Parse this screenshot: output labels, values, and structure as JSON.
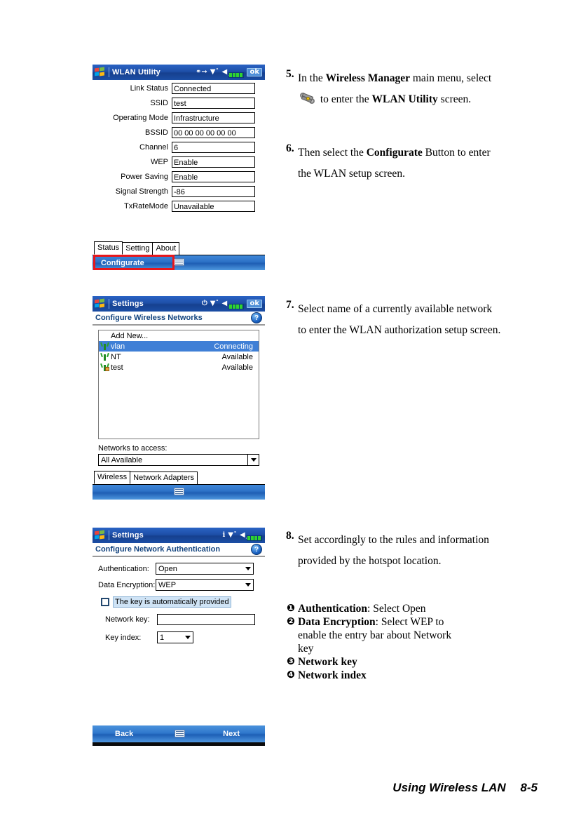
{
  "panels": {
    "wlan_utility": {
      "titlebar": {
        "title": "WLAN Utility",
        "ok_label": "ok"
      },
      "fields": [
        {
          "label": "Link Status",
          "value": "Connected"
        },
        {
          "label": "SSID",
          "value": "test"
        },
        {
          "label": "Operating Mode",
          "value": "Infrastructure"
        },
        {
          "label": "BSSID",
          "value": "00 00 00 00 00 00"
        },
        {
          "label": "Channel",
          "value": "6"
        },
        {
          "label": "WEP",
          "value": "Enable"
        },
        {
          "label": "Power Saving",
          "value": "Enable"
        },
        {
          "label": "Signal Strength",
          "value": "-86"
        },
        {
          "label": "TxRateMode",
          "value": "Unavailable"
        }
      ],
      "tabs": [
        {
          "label": "Status",
          "active": true
        },
        {
          "label": "Setting",
          "active": false
        },
        {
          "label": "About",
          "active": false
        }
      ],
      "command_bar": {
        "button": "Configurate",
        "highlight_color": "#e8171b"
      }
    },
    "wireless_networks": {
      "titlebar": {
        "title": "Settings",
        "ok_label": "ok"
      },
      "header": "Configure Wireless Networks",
      "list": {
        "add_new": "Add New...",
        "rows": [
          {
            "name": "vlan",
            "status": "Connecting",
            "selected": true,
            "secured": false
          },
          {
            "name": "NT",
            "status": "Available",
            "selected": false,
            "secured": false
          },
          {
            "name": "test",
            "status": "Available",
            "selected": false,
            "secured": true
          }
        ]
      },
      "networks_to_access_label": "Networks to access:",
      "networks_to_access_value": "All Available",
      "tabs": [
        {
          "label": "Wireless",
          "active": true
        },
        {
          "label": "Network Adapters",
          "active": false
        }
      ]
    },
    "network_auth": {
      "titlebar": {
        "title": "Settings"
      },
      "header": "Configure Network Authentication",
      "authentication_label": "Authentication:",
      "authentication_value": "Open",
      "encryption_label": "Data Encryption:",
      "encryption_value": "WEP",
      "auto_key_label": "The key is automatically provided",
      "network_key_label": "Network key:",
      "network_key_value": "",
      "key_index_label": "Key index:",
      "key_index_value": "1",
      "bottom_bar": {
        "back": "Back",
        "next": "Next"
      }
    }
  },
  "instructions": [
    {
      "num": "5.",
      "segments": [
        {
          "t": "In the ",
          "bold": false
        },
        {
          "t": "Wireless Manager",
          "bold": true
        },
        {
          "t": " main menu, select ",
          "bold": false
        },
        {
          "t": "[wrench-icon]",
          "icon": true
        },
        {
          "t": " to enter the ",
          "bold": false
        },
        {
          "t": "WLAN Utility",
          "bold": true
        },
        {
          "t": " screen.",
          "bold": false
        }
      ]
    },
    {
      "num": "6.",
      "segments": [
        {
          "t": "Then select the ",
          "bold": false
        },
        {
          "t": "Configurate",
          "bold": true
        },
        {
          "t": " Button to enter the WLAN setup screen.",
          "bold": false
        }
      ]
    },
    {
      "num": "7.",
      "segments": [
        {
          "t": "Select name of a currently available network to enter the WLAN authorization setup screen.",
          "bold": false
        }
      ]
    },
    {
      "num": "8.",
      "segments": [
        {
          "t": "Set accordingly to the rules and information provided by the hotspot location.",
          "bold": false
        }
      ]
    }
  ],
  "bullets": [
    {
      "marker": "❶",
      "bold_part": "Authentication",
      "rest": ": Select Open"
    },
    {
      "marker": "❷",
      "bold_part": "Data Encryption",
      "rest": ": Select WEP to"
    },
    {
      "marker": "",
      "bold_part": "",
      "rest": "enable the entry bar about Network"
    },
    {
      "marker": "",
      "bold_part": "",
      "rest": "key"
    },
    {
      "marker": "❸",
      "bold_part": "Network key",
      "rest": ""
    },
    {
      "marker": "❹",
      "bold_part": "Network index",
      "rest": ""
    }
  ],
  "footer": {
    "title": "Using Wireless LAN",
    "page": "8-5"
  }
}
